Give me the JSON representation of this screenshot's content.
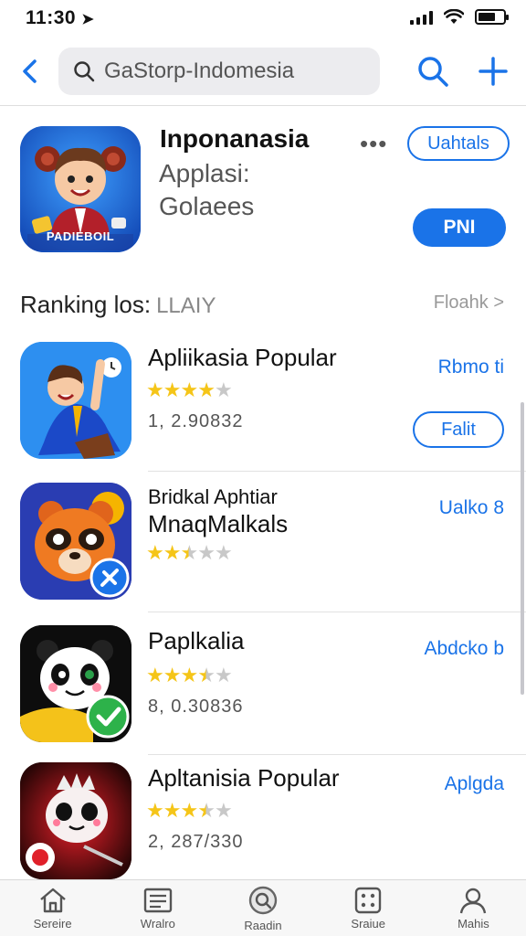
{
  "status_bar": {
    "time": "11:30"
  },
  "nav": {
    "search_value": "GaStorp-Indomesia",
    "search_placeholder": "GaStorp-Indomesia"
  },
  "featured": {
    "title": "Inponanasia",
    "subtitle1": "Applasi:",
    "subtitle2": "Golaees",
    "icon_caption": "PADIEBOIL",
    "more": "•••",
    "details_button": "Uahtals",
    "get_button": "PNI"
  },
  "section": {
    "title": "Ranking los:",
    "title_muted": "LLAIY",
    "link": "Floahk >"
  },
  "apps": [
    {
      "name": "Apliikasia Popular",
      "name2": "",
      "rating": 4,
      "count": "1, 2.90832",
      "link": "Rbmo ti",
      "button": "Falit",
      "icon": "boy-cheer"
    },
    {
      "name": "Bridkal Aphtiar",
      "name2": "MnaqMalkals",
      "rating": 2.5,
      "count": "",
      "link": "Ualko 8",
      "button": "",
      "icon": "panda-orange"
    },
    {
      "name": "Paplkalia",
      "name2": "",
      "rating": 3.5,
      "count": "8, 0.30836",
      "link": "Abdcko b",
      "button": "",
      "icon": "panda-white"
    },
    {
      "name": "Apltanisia Popular",
      "name2": "",
      "rating": 3.5,
      "count": "2, 287/330",
      "link": "Aplgda",
      "button": "",
      "icon": "panda-red"
    }
  ],
  "tabs": [
    {
      "label": "Sereire",
      "icon": "home-icon"
    },
    {
      "label": "Wralro",
      "icon": "news-icon"
    },
    {
      "label": "Raadin",
      "icon": "search-icon"
    },
    {
      "label": "Sraiue",
      "icon": "games-icon"
    },
    {
      "label": "Mahis",
      "icon": "profile-icon"
    }
  ],
  "colors": {
    "accent": "#1a73e8",
    "star": "#f5c518"
  }
}
